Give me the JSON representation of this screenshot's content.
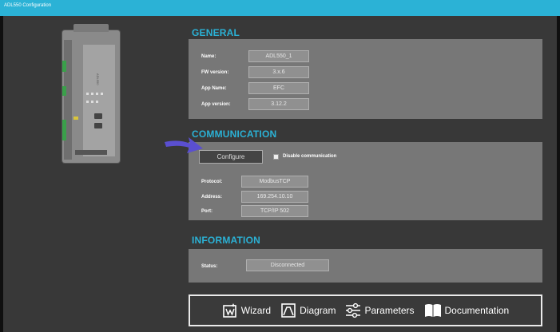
{
  "window": {
    "title": "ADL550 Configuration"
  },
  "device": {
    "vertical_label": "ADL550"
  },
  "general": {
    "title": "GENERAL",
    "fields": [
      {
        "label": "Name:",
        "value": "ADL550_1"
      },
      {
        "label": "FW version:",
        "value": "3.x.6"
      },
      {
        "label": "App Name:",
        "value": "EFC"
      },
      {
        "label": "App version:",
        "value": "3.12.2"
      }
    ]
  },
  "communication": {
    "title": "COMMUNICATION",
    "configure_label": "Configure",
    "disable_label": "Disable communication",
    "fields": [
      {
        "label": "Protocol:",
        "value": "ModbusTCP"
      },
      {
        "label": "Address:",
        "value": "169.254.10.10"
      },
      {
        "label": "Port:",
        "value": "TCP/IP 502"
      }
    ]
  },
  "information": {
    "title": "INFORMATION",
    "status_label": "Status:",
    "status_value": "Disconnected"
  },
  "toolbar": {
    "items": [
      {
        "label": "Wizard",
        "icon": "wizard-icon"
      },
      {
        "label": "Diagram",
        "icon": "diagram-icon"
      },
      {
        "label": "Parameters",
        "icon": "sliders-icon"
      },
      {
        "label": "Documentation",
        "icon": "book-icon"
      }
    ]
  },
  "colors": {
    "accent": "#2bb2d6",
    "panel": "#777777",
    "background": "#383838",
    "arrow": "#5a4fd0"
  }
}
